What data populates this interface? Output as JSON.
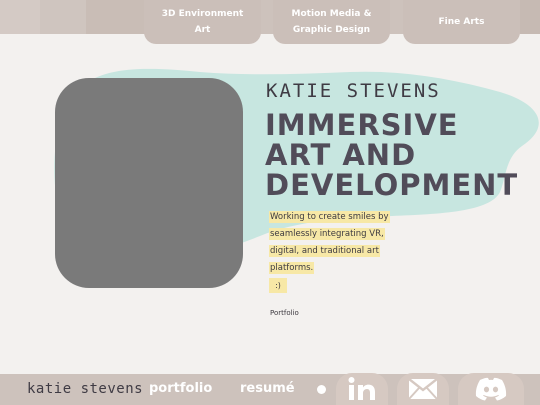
{
  "top_nav": {
    "tabs": [
      {
        "label_line1": "3D Environment",
        "label_line2": "Art"
      },
      {
        "label_line1": "Motion Media &",
        "label_line2": "Graphic Design"
      },
      {
        "label_line1": "Fine Arts",
        "label_line2": ""
      }
    ]
  },
  "hero": {
    "name": "KATIE STEVENS",
    "headline": [
      "IMMERSIVE",
      "ART AND",
      "DEVELOPMENT"
    ],
    "description_lines": [
      "Working to create smiles by",
      "seamlessly integrating VR,",
      "digital, and traditional art",
      "platforms."
    ],
    "emoticon": ":)",
    "portfolio_link": "Portfolio"
  },
  "bottom_nav": {
    "brand": "katie stevens",
    "links": [
      "portfolio",
      "resumé"
    ],
    "social_icons": [
      "linkedin-icon",
      "mail-icon",
      "discord-icon"
    ]
  },
  "colors": {
    "bar": "#cdc2bc",
    "tab": "#cbbfb9",
    "blob": "#c7e6e0",
    "photo": "#7a7a7a",
    "headline": "#514c59",
    "highlight": "#f7e8a6",
    "page": "#f3f1ef"
  }
}
